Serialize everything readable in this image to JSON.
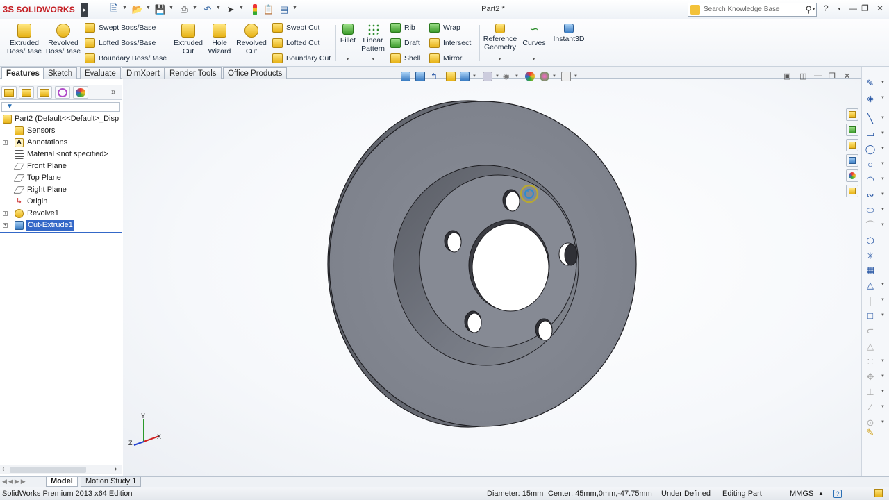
{
  "app": {
    "logo_text": "SOLIDWORKS",
    "logo_mark": "3S",
    "document_title": "Part2 *"
  },
  "search": {
    "placeholder": "Search Knowledge Base"
  },
  "ribbon": {
    "extruded_boss": "Extruded Boss/Base",
    "revolved_boss": "Revolved Boss/Base",
    "swept_boss": "Swept Boss/Base",
    "lofted_boss": "Lofted Boss/Base",
    "boundary_boss": "Boundary Boss/Base",
    "extruded_cut": "Extruded Cut",
    "hole_wizard": "Hole Wizard",
    "revolved_cut": "Revolved Cut",
    "swept_cut": "Swept Cut",
    "lofted_cut": "Lofted Cut",
    "boundary_cut": "Boundary Cut",
    "fillet": "Fillet",
    "linear_pattern": "Linear Pattern",
    "rib": "Rib",
    "draft": "Draft",
    "shell": "Shell",
    "wrap": "Wrap",
    "intersect": "Intersect",
    "mirror": "Mirror",
    "reference_geometry": "Reference Geometry",
    "curves": "Curves",
    "instant3d": "Instant3D"
  },
  "tabs": [
    "Features",
    "Sketch",
    "Evaluate",
    "DimXpert",
    "Render Tools",
    "Office Products"
  ],
  "tree": {
    "root": "Part2  (Default<<Default>_Disp",
    "items": [
      "Sensors",
      "Annotations",
      "Material <not specified>",
      "Front Plane",
      "Top Plane",
      "Right Plane",
      "Origin",
      "Revolve1",
      "Cut-Extrude1"
    ]
  },
  "triad": {
    "x": "X",
    "y": "Y",
    "z": "Z"
  },
  "bottom_tabs": [
    "Model",
    "Motion Study 1"
  ],
  "status": {
    "edition": "SolidWorks Premium 2013 x64 Edition",
    "diameter": "Diameter: 15mm",
    "center": "Center: 45mm,0mm,-47.75mm",
    "definition": "Under Defined",
    "mode": "Editing Part",
    "units": "MMGS",
    "units_arrow": "▲",
    "help": "?"
  },
  "colors": {
    "accent": "#c41e23",
    "selection": "#3468c8",
    "part": "#7e828c"
  }
}
